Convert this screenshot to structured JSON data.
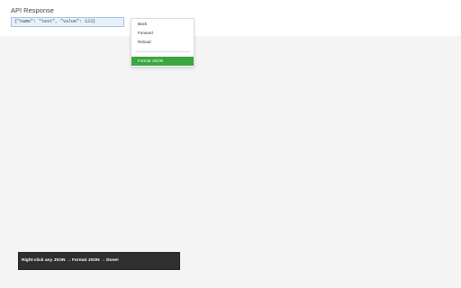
{
  "page": {
    "title": "API Response"
  },
  "json_box": {
    "value": "{\"name\": \"test\", \"value\": 123}"
  },
  "context_menu": {
    "items": [
      {
        "label": "Back"
      },
      {
        "label": "Forward"
      },
      {
        "label": "Reload"
      }
    ],
    "highlighted_item": {
      "label": "Format JSON"
    }
  },
  "hint": {
    "text": "Right-click any JSON → Format JSON → Done!"
  },
  "colors": {
    "accent_green": "#3ca63f",
    "json_box_bg": "#e8f1fb",
    "hint_bg": "#2f2f2f"
  }
}
